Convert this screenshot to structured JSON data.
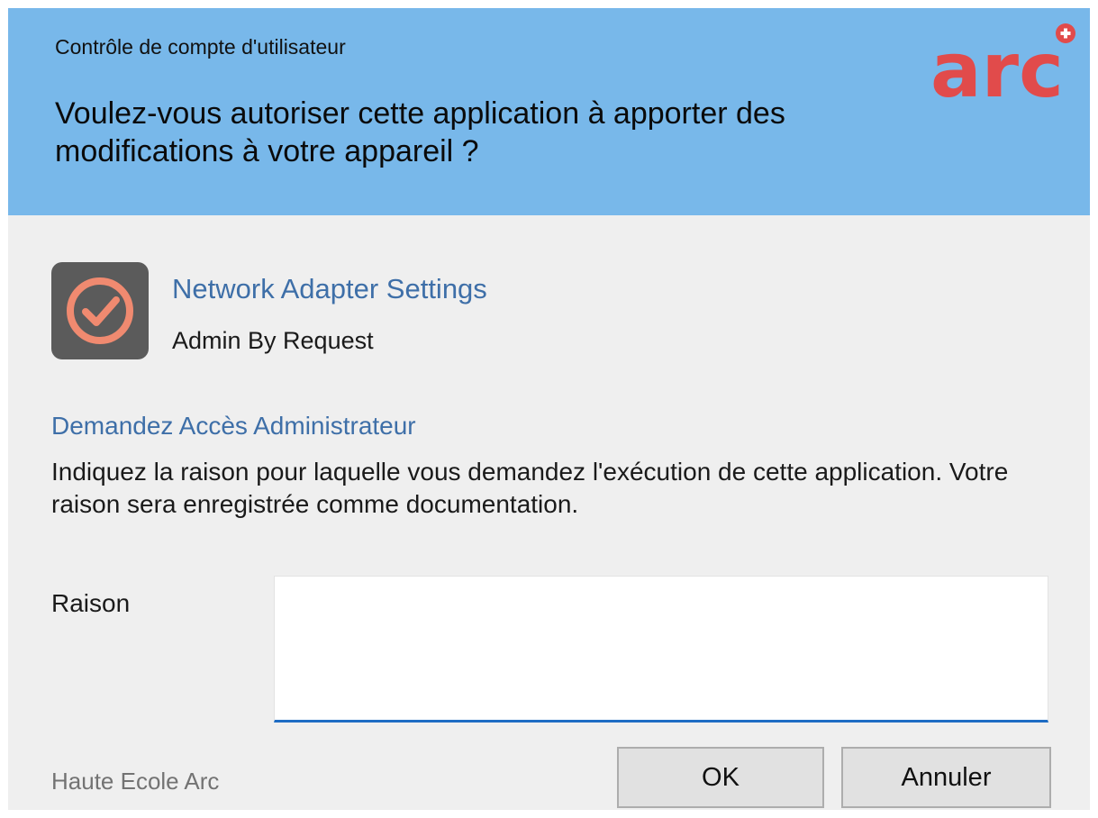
{
  "header": {
    "caption": "Contrôle de compte d'utilisateur",
    "question": "Voulez-vous autoriser cette application à apporter des modifications à votre appareil ?",
    "logo_text": "arc",
    "background_color": "#78b8ea"
  },
  "app": {
    "icon": "check-circle-icon",
    "name": "Network Adapter Settings",
    "publisher": "Admin By Request"
  },
  "request": {
    "title": "Demandez Accès Administrateur",
    "instructions": "Indiquez la raison pour laquelle vous demandez l'exécution de cette application. Votre raison sera enregistrée comme documentation."
  },
  "reason": {
    "label": "Raison",
    "value": ""
  },
  "footer": {
    "organization": "Haute Ecole Arc",
    "ok_label": "OK",
    "cancel_label": "Annuler"
  },
  "colors": {
    "accent_text": "#3e6fa8",
    "brand_red": "#e14b4b",
    "input_underline": "#1e6cc4"
  }
}
